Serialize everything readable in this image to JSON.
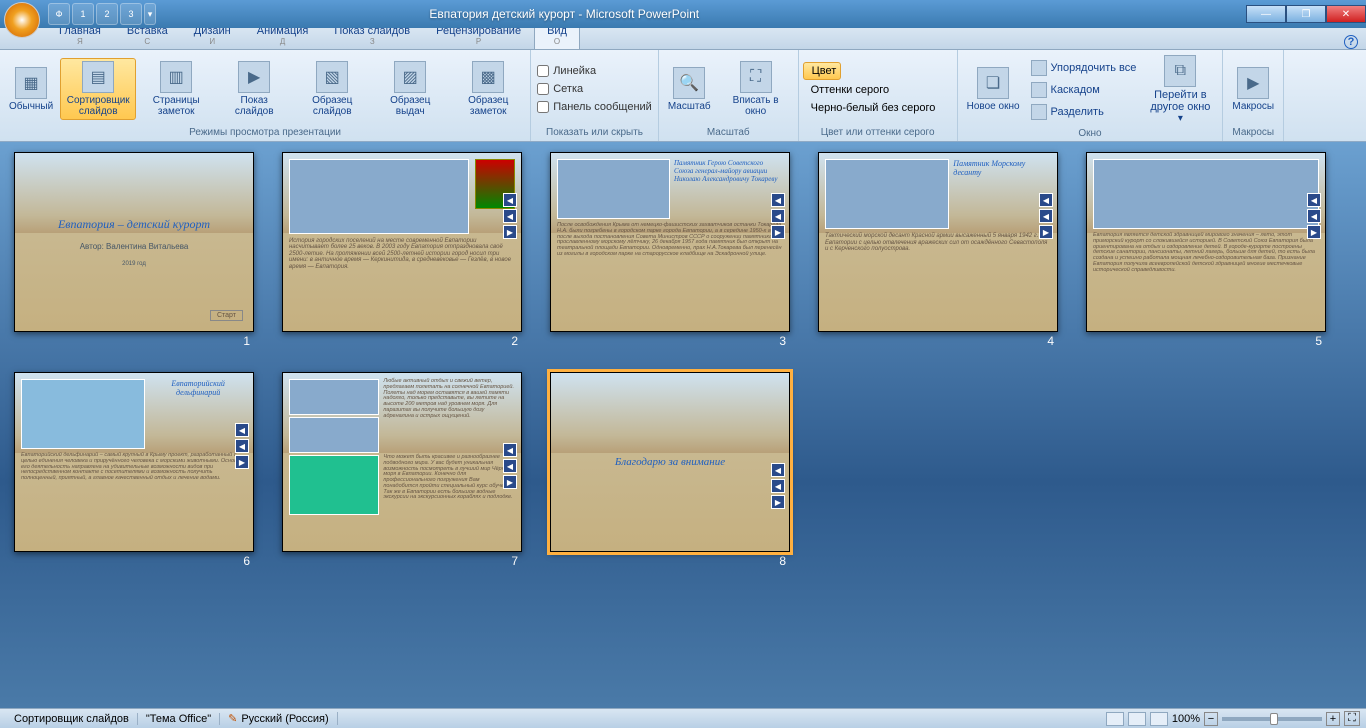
{
  "window": {
    "title": "Евпатория детский курорт - Microsoft PowerPoint"
  },
  "qat": {
    "items": [
      "Ф",
      "1",
      "2",
      "3"
    ]
  },
  "tabs": {
    "items": [
      "Главная",
      "Вставка",
      "Дизайн",
      "Анимация",
      "Показ слайдов",
      "Рецензирование",
      "Вид"
    ],
    "keytips": [
      "Я",
      "С",
      "И",
      "Д",
      "З",
      "Р",
      "О"
    ],
    "active": 6
  },
  "ribbon": {
    "views": {
      "label": "Режимы просмотра презентации",
      "normal": "Обычный",
      "sorter": "Сортировщик слайдов",
      "notes": "Страницы заметок",
      "show": "Показ слайдов",
      "master_slide": "Образец слайдов",
      "master_handout": "Образец выдач",
      "master_notes": "Образец заметок"
    },
    "show_hide": {
      "label": "Показать или скрыть",
      "ruler": "Линейка",
      "grid": "Сетка",
      "panel": "Панель сообщений"
    },
    "zoom": {
      "label": "Масштаб",
      "zoom": "Масштаб",
      "fit": "Вписать в окно"
    },
    "color": {
      "label": "Цвет или оттенки серого",
      "color": "Цвет",
      "gray": "Оттенки серого",
      "bw": "Черно-белый без серого"
    },
    "window": {
      "label": "Окно",
      "new": "Новое окно",
      "arrange": "Упорядочить все",
      "cascade": "Каскадом",
      "split": "Разделить",
      "switch": "Перейти в другое окно"
    },
    "macros": {
      "label": "Макросы",
      "btn": "Макросы"
    }
  },
  "slides": [
    {
      "n": "1",
      "title": "Евпатория – детский курорт",
      "sub": "Автор: Валентина Витальева",
      "year": "2019 год",
      "btn": "Старт"
    },
    {
      "n": "2",
      "text": "История городских поселений на месте современной Евпатории насчитывает более 25 веков. В 2003 году Евпатория отпраздновала своё 2500-летие. На протяжении всей 2500-летней истории город носил три имени: в античное время — Керкинитида, в средневековье — Гезлёв, в новое время — Евпатория."
    },
    {
      "n": "3",
      "caption": "Памятник Герою Советского Союза генерал-майору авиации Николаю Александровичу Токареву",
      "text": "После освобождения Крыма от немецко-фашистских захватчиков останки Токарева Н.А. были погребены в городском парке города Евпатории, а в середине 1950-х годов после выхода постановления Совета Министров СССР о сооружении памятника прославленному морскому лётчику, 26 декабря 1957 года памятник был открыт на театральной площади Евпатории. Одновременно, прах Н.А.Токарева был перенесён из могилы в городском парке на старорусское кладбище на Эскадронной улице."
    },
    {
      "n": "4",
      "caption": "Памятник Морскому десанту",
      "text": "Тактический морской десант Красной армии высаженный 5 января 1942 г. в Евпатории с целью отвлечения вражеских сил от осаждённого Севастополя и с Керченского полуострова."
    },
    {
      "n": "5",
      "text": "Евпатория является детской здравницей мирового значения – лето, этот приморский курорт со сложившейся историей. В Советский Союз Евпатория была ориентирована на отдых и оздоровление детей. В городе-курорте построены детские санатории, пансионаты, летний лагерь, больше для детей, то есть была создана и успешно работала мощная лечебно-оздоровительная база. Признание Евпатория получила всеевропейской детской здравницей многие местечковые исторической справедливости."
    },
    {
      "n": "6",
      "caption": "Евпаторийский дельфинарий",
      "text": "Евпаторийский дельфинарий – самый крупный в Крыму проект, разработанный с целью единения человека и приручённого человека с морскими животными. Основная его деятельность направлена на удивительные возможности видов при непосредственном контакте с посетителями и возможность получить полноценный, приятный, а главное качественный отдых и лечение водами."
    },
    {
      "n": "7",
      "text1": "Любые активный отдых и свежий ветер, предлагаем полетать на солнечной Евпаторией. Полеты над морем оставятся в вашей памяти надолго, только представьте, вы летите на высоте 200 метров над уровнем моря. Для паразитах вы получите большую дозу адреналина и острых ощущений.",
      "text2": "Что может быть красивее и разнообразнее подводного мира. У вас будет уникальная возможность посмотреть в лучший мир Чёрного моря в Евпатории. Конечно для профессионального погружения Вам понадобится пройти специальный курс обучения. Так же в Евпатории есть большое водные экскурсии на экскурсионных кораблях и подлодке."
    },
    {
      "n": "8",
      "title": "Благодарю за внимание"
    }
  ],
  "selected_slide": 8,
  "status": {
    "mode": "Сортировщик слайдов",
    "theme": "\"Тема Office\"",
    "lang": "Русский (Россия)",
    "zoom": "100%"
  }
}
